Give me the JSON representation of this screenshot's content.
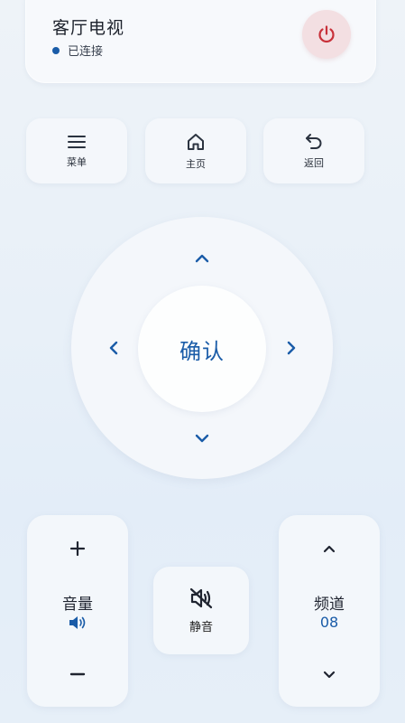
{
  "device": {
    "name": "客厅电视",
    "status": "已连接",
    "power_icon": "power-icon"
  },
  "functions": [
    {
      "label": "菜单",
      "icon": "menu-icon"
    },
    {
      "label": "主页",
      "icon": "home-icon"
    },
    {
      "label": "返回",
      "icon": "back-icon"
    }
  ],
  "dpad": {
    "ok_label": "确认"
  },
  "volume": {
    "label": "音量",
    "up": "+",
    "down": "−",
    "icon": "speaker-icon"
  },
  "mute": {
    "label": "静音",
    "icon": "mute-icon"
  },
  "channel": {
    "label": "频道",
    "number": "08"
  },
  "colors": {
    "accent": "#1a5ca8",
    "power": "#c8313a",
    "power_bg": "#f3dfe2"
  }
}
